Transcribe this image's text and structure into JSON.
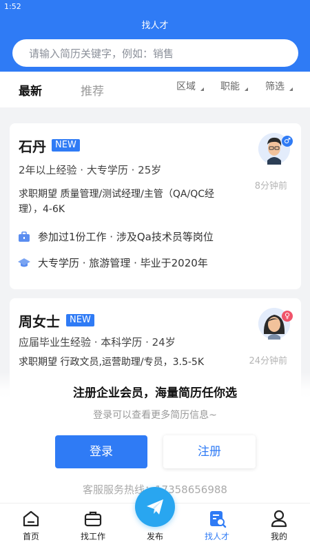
{
  "status_bar": {
    "time": "1:52"
  },
  "header": {
    "title": "找人才"
  },
  "search": {
    "placeholder": "请输入简历关键字，例如：销售"
  },
  "tabs": [
    {
      "label": "最新",
      "active": true
    },
    {
      "label": "推荐",
      "active": false
    }
  ],
  "filters": [
    {
      "label": "区域"
    },
    {
      "label": "职能"
    },
    {
      "label": "筛选"
    }
  ],
  "candidates": [
    {
      "name": "石丹",
      "badge": "NEW",
      "meta": "2年以上经验 · 大专学历 · 25岁",
      "expectation": "求职期望 质量管理/测试经理/主管（QA/QC经理），4-6K",
      "work": "参加过1份工作 · 涉及Qa技术员等岗位",
      "education": "大专学历 · 旅游管理 · 毕业于2020年",
      "time_ago": "8分钟前",
      "gender_symbol": "♂",
      "gender_color": "#2f7bf5"
    },
    {
      "name": "周女士",
      "badge": "NEW",
      "meta": "应届毕业生经验 · 本科学历 · 24岁",
      "expectation": "求职期望 行政文员,运营助理/专员，3.5-5K",
      "time_ago": "24分钟前",
      "gender_symbol": "♀",
      "gender_color": "#f0546b"
    }
  ],
  "promo": {
    "title": "注册企业会员，海量简历任你选",
    "subtitle": "登录可以查看更多简历信息~",
    "login_label": "登录",
    "register_label": "注册",
    "hotline": "客服服务热线：17358656988"
  },
  "bottom_nav": {
    "items": [
      {
        "label": "首页",
        "icon": "home-icon"
      },
      {
        "label": "找工作",
        "icon": "briefcase-icon"
      },
      {
        "label": "发布",
        "icon": "paper-plane-icon"
      },
      {
        "label": "找人才",
        "icon": "resume-search-icon",
        "active": true
      },
      {
        "label": "我的",
        "icon": "user-icon"
      }
    ]
  },
  "colors": {
    "primary": "#2f7bf5",
    "fab": "#29a6f0"
  }
}
